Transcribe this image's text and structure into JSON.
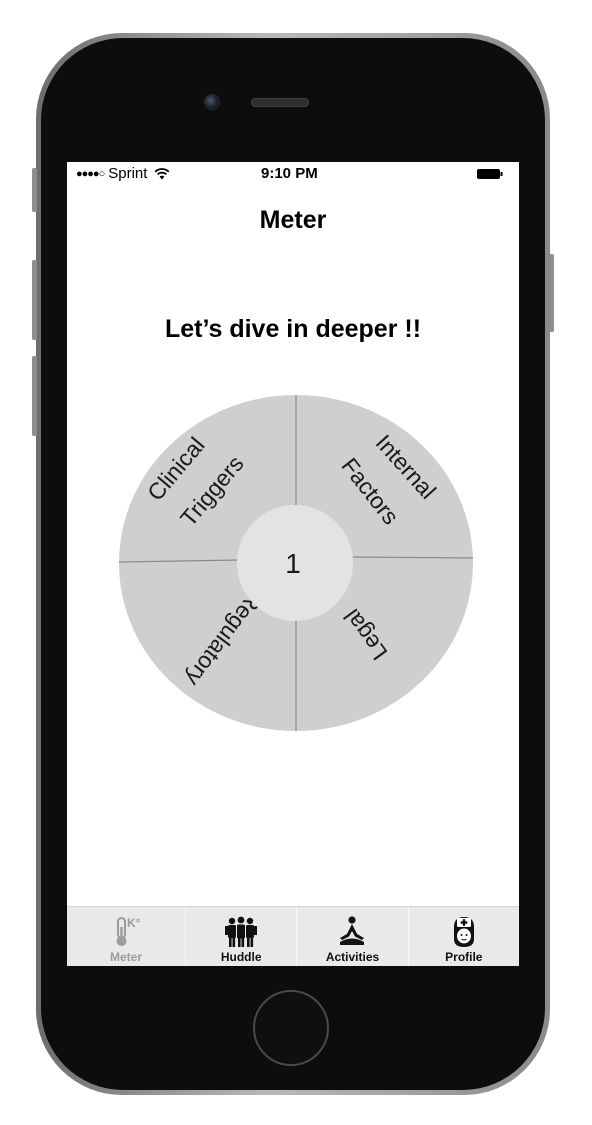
{
  "status_bar": {
    "signal_dots": "●●●●○",
    "carrier": "Sprint",
    "time": "9:10 PM"
  },
  "nav": {
    "title": "Meter"
  },
  "main": {
    "headline": "Let’s dive in deeper !!",
    "wheel": {
      "center_value": "1",
      "segments": [
        {
          "line1": "Clinical",
          "line2": "Triggers"
        },
        {
          "line1": "Internal",
          "line2": "Factors"
        },
        {
          "label": "Legal"
        },
        {
          "label": "Regulatory"
        }
      ]
    }
  },
  "tab_bar": {
    "tabs": [
      {
        "label": "Meter",
        "icon": "thermometer-icon",
        "active": true
      },
      {
        "label": "Huddle",
        "icon": "group-icon",
        "active": false
      },
      {
        "label": "Activities",
        "icon": "meditation-icon",
        "active": false
      },
      {
        "label": "Profile",
        "icon": "nurse-icon",
        "active": false
      }
    ]
  },
  "colors": {
    "wheel_fill": "#cfcfcf",
    "wheel_center": "#e3e3e3",
    "tab_bar_bg": "#e9e9ea",
    "phone_body": "#0d0d0d"
  }
}
